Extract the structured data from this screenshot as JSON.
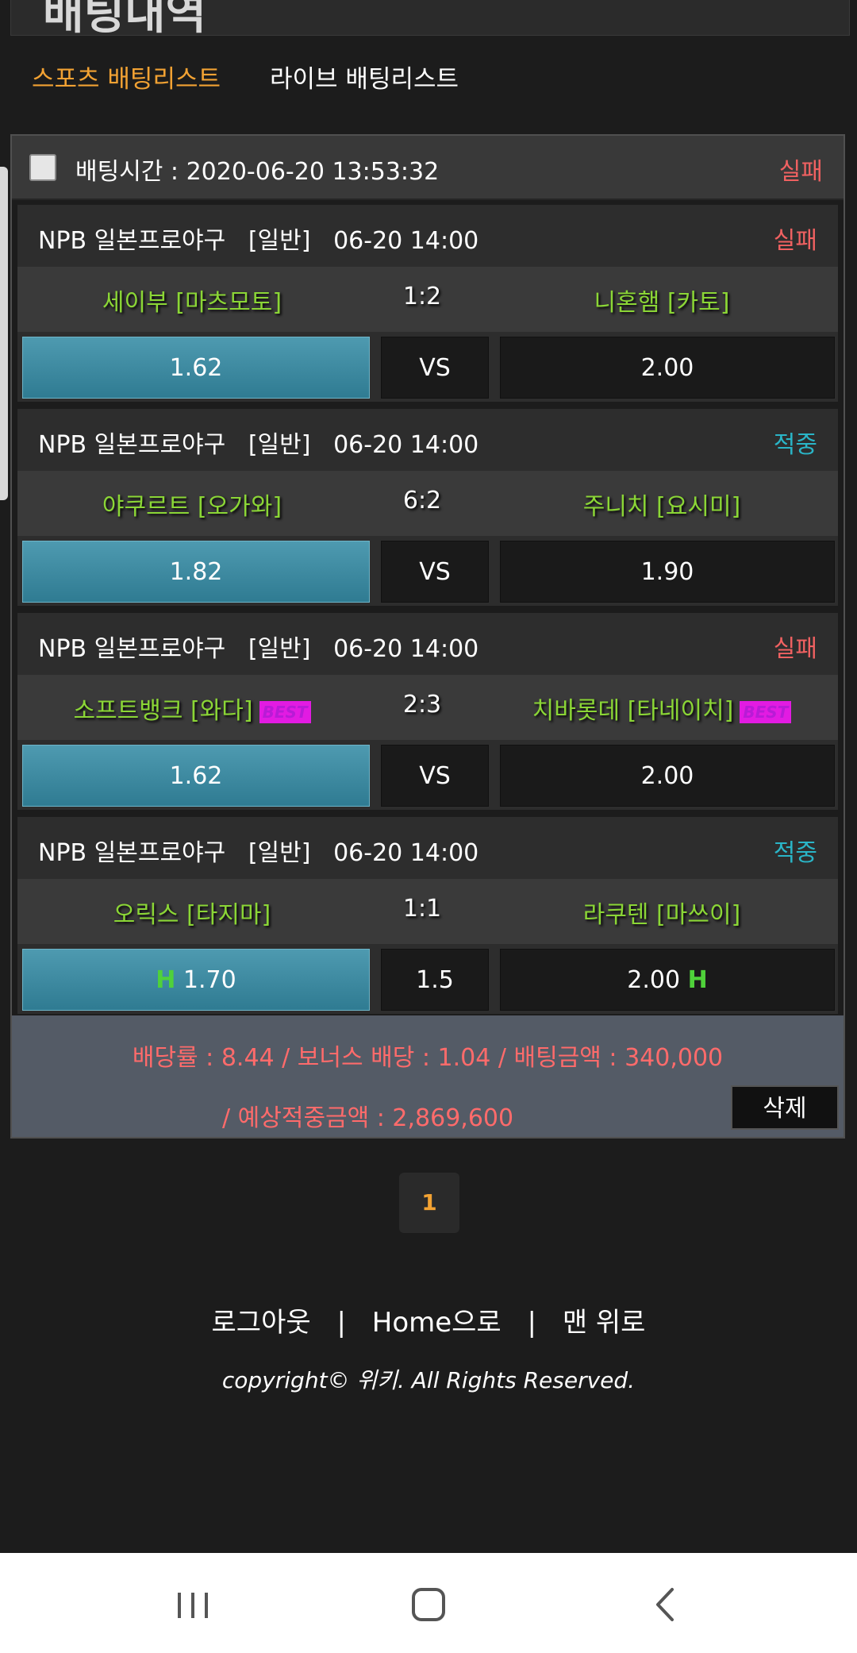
{
  "header": {
    "title": "배팅내역"
  },
  "tabs": [
    {
      "label": "스포츠 배팅리스트",
      "active": true
    },
    {
      "label": "라이브 배팅리스트",
      "active": false
    }
  ],
  "bet": {
    "time_label": "배팅시간 : 2020-06-20 13:53:32",
    "status": "실패",
    "games": [
      {
        "info": "NPB 일본프로야구   [일반]   06-20 14:00",
        "status": "실패",
        "status_color": "#f06161",
        "home": "세이부 [마츠모토]",
        "away": "니혼햄 [카토]",
        "score": "1:2",
        "home_odd": "1.62",
        "mid": "VS",
        "away_odd": "2.00"
      },
      {
        "info": "NPB 일본프로야구   [일반]   06-20 14:00",
        "status": "적중",
        "status_color": "#2ab5c7",
        "home": "야쿠르트 [오가와]",
        "away": "주니치 [요시미]",
        "score": "6:2",
        "home_odd": "1.82",
        "mid": "VS",
        "away_odd": "1.90"
      },
      {
        "info": "NPB 일본프로야구   [일반]   06-20 14:00",
        "status": "실패",
        "status_color": "#f06161",
        "home": "소프트뱅크 [와다]",
        "away": "치바롯데 [타네이치]",
        "home_badge": "BEST",
        "away_badge": "BEST",
        "score": "2:3",
        "home_odd": "1.62",
        "mid": "VS",
        "away_odd": "2.00"
      },
      {
        "info": "NPB 일본프로야구   [일반]   06-20 14:00",
        "status": "적중",
        "status_color": "#2ab5c7",
        "home": "오릭스 [타지마]",
        "away": "라쿠텐 [마쓰이]",
        "score": "1:1",
        "home_mark": "H",
        "home_odd": "1.70",
        "mid": "1.5",
        "away_odd": "2.00",
        "away_mark": "H"
      }
    ],
    "summary_line1": "배당률 : 8.44 / 보너스 배당 : 1.04 / 배팅금액 : 340,000",
    "summary_line2": "/ 예상적중금액 : 2,869,600",
    "delete_label": "삭제"
  },
  "pagination": {
    "current": "1"
  },
  "footer": {
    "logout": "로그아웃",
    "sep": "|",
    "home": "Home으로",
    "top": "맨 위로",
    "copyright": "copyright© 위키. All Rights Reserved."
  },
  "navbar": {
    "icons": [
      "recent-apps-icon",
      "home-icon",
      "back-icon"
    ]
  }
}
